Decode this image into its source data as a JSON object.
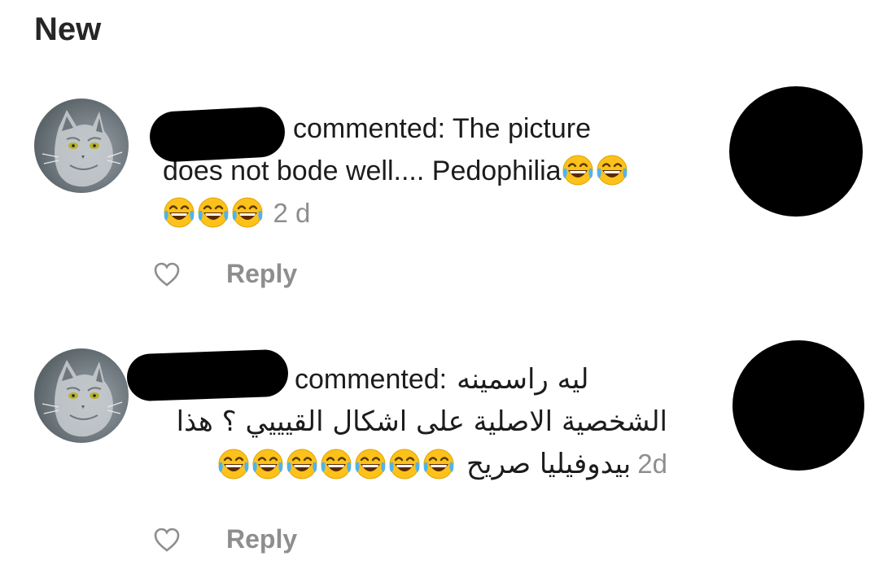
{
  "section": {
    "title": "New"
  },
  "notifications": [
    {
      "text_line1": "commented: The picture",
      "text_line2": "does not bode well.... Pedophilia",
      "time": "2 d",
      "reply_label": "Reply",
      "icons": {
        "avatar": "cat-avatar",
        "like": "heart-outline-icon",
        "emoji": "tears-of-joy-emoji"
      }
    },
    {
      "text_line1_prefix": "commented:",
      "text_line1_arabic": "ليه راسمينه",
      "text_line2_arabic": "الشخصية الاصلية على اشكال القيييي ؟ هذا",
      "text_line3_arabic": "بيدوفيليا صريح",
      "time": "2d",
      "reply_label": "Reply",
      "icons": {
        "avatar": "cat-avatar",
        "like": "heart-outline-icon",
        "emoji": "tears-of-joy-emoji"
      }
    }
  ],
  "colors": {
    "text": "#1c1c1c",
    "muted": "#8e8e8e",
    "emoji_face": "#fcc21b",
    "redaction": "#000000"
  }
}
